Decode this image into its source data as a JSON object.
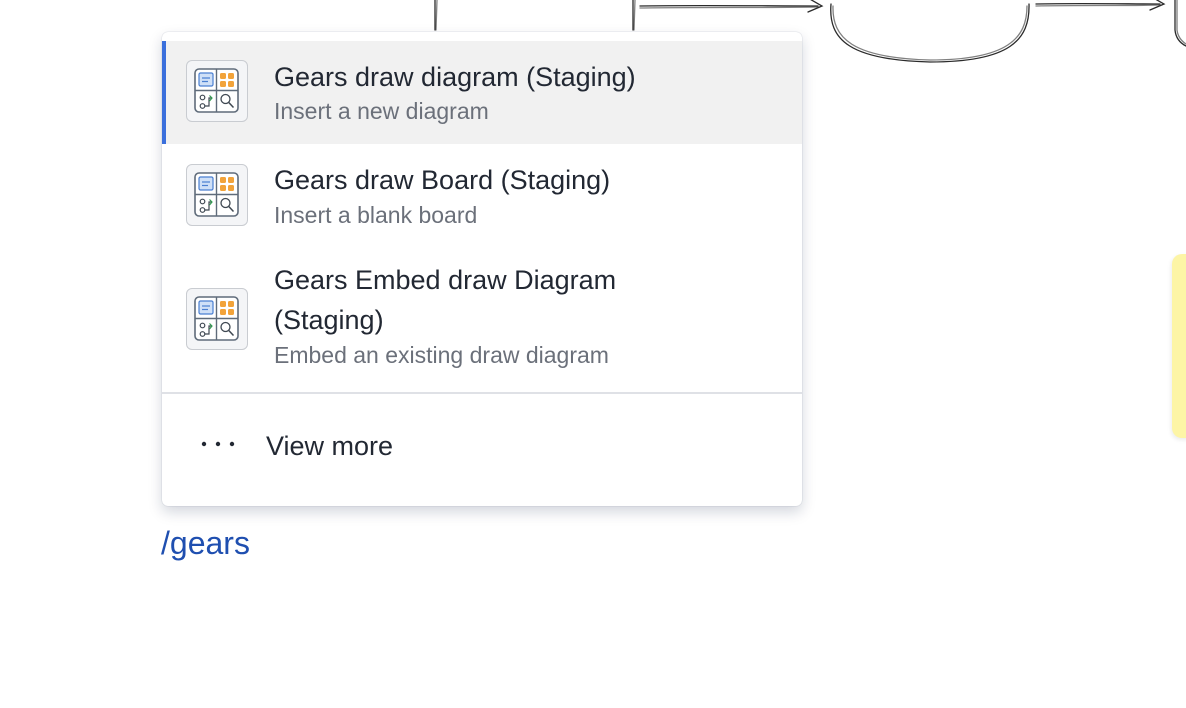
{
  "menu": {
    "items": [
      {
        "title": "Gears draw diagram (Staging)",
        "description": "Insert a new diagram",
        "icon": "gears-draw-app-icon",
        "selected": true
      },
      {
        "title": "Gears draw Board (Staging)",
        "description": "Insert a blank board",
        "icon": "gears-draw-app-icon",
        "selected": false
      },
      {
        "title": "Gears Embed draw Diagram (Staging)",
        "description": "Embed an existing draw diagram",
        "icon": "gears-draw-app-icon",
        "selected": false
      }
    ],
    "view_more": {
      "label": "View more",
      "icon": "more-horizontal-icon"
    }
  },
  "editor": {
    "command_text": "/gears"
  },
  "colors": {
    "selected_accent": "#3a6fdc",
    "command_text": "#1f4fb0",
    "sticky_note": "#fdf5a6"
  }
}
